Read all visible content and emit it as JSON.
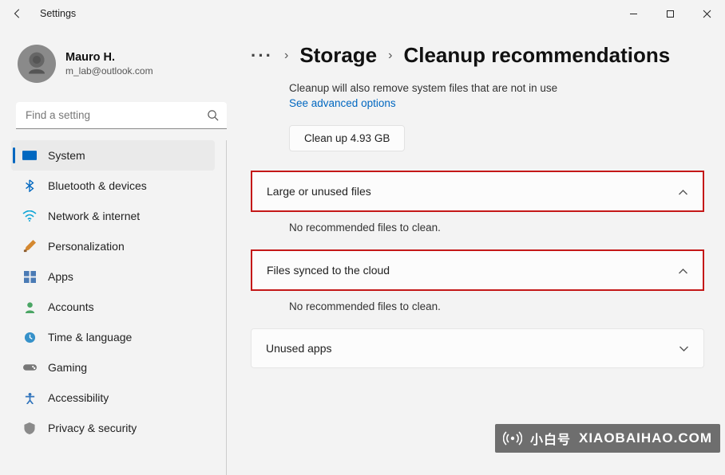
{
  "window": {
    "title": "Settings"
  },
  "profile": {
    "name": "Mauro H.",
    "email": "m_lab@outlook.com"
  },
  "search": {
    "placeholder": "Find a setting"
  },
  "nav": [
    {
      "key": "system",
      "label": "System"
    },
    {
      "key": "bluetooth",
      "label": "Bluetooth & devices"
    },
    {
      "key": "network",
      "label": "Network & internet"
    },
    {
      "key": "personalization",
      "label": "Personalization"
    },
    {
      "key": "apps",
      "label": "Apps"
    },
    {
      "key": "accounts",
      "label": "Accounts"
    },
    {
      "key": "time",
      "label": "Time & language"
    },
    {
      "key": "gaming",
      "label": "Gaming"
    },
    {
      "key": "accessibility",
      "label": "Accessibility"
    },
    {
      "key": "privacy",
      "label": "Privacy & security"
    }
  ],
  "breadcrumb": {
    "parent": "Storage",
    "current": "Cleanup recommendations"
  },
  "intro": {
    "text": "Cleanup will also remove system files that are not in use",
    "link": "See advanced options"
  },
  "clean_button": "Clean up 4.93 GB",
  "sections": {
    "large": {
      "title": "Large or unused files",
      "body": "No recommended files to clean."
    },
    "cloud": {
      "title": "Files synced to the cloud",
      "body": "No recommended files to clean."
    },
    "unused": {
      "title": "Unused apps"
    }
  },
  "watermark": {
    "cn": "小白号",
    "en": "XIAOBAIHAO.COM"
  }
}
